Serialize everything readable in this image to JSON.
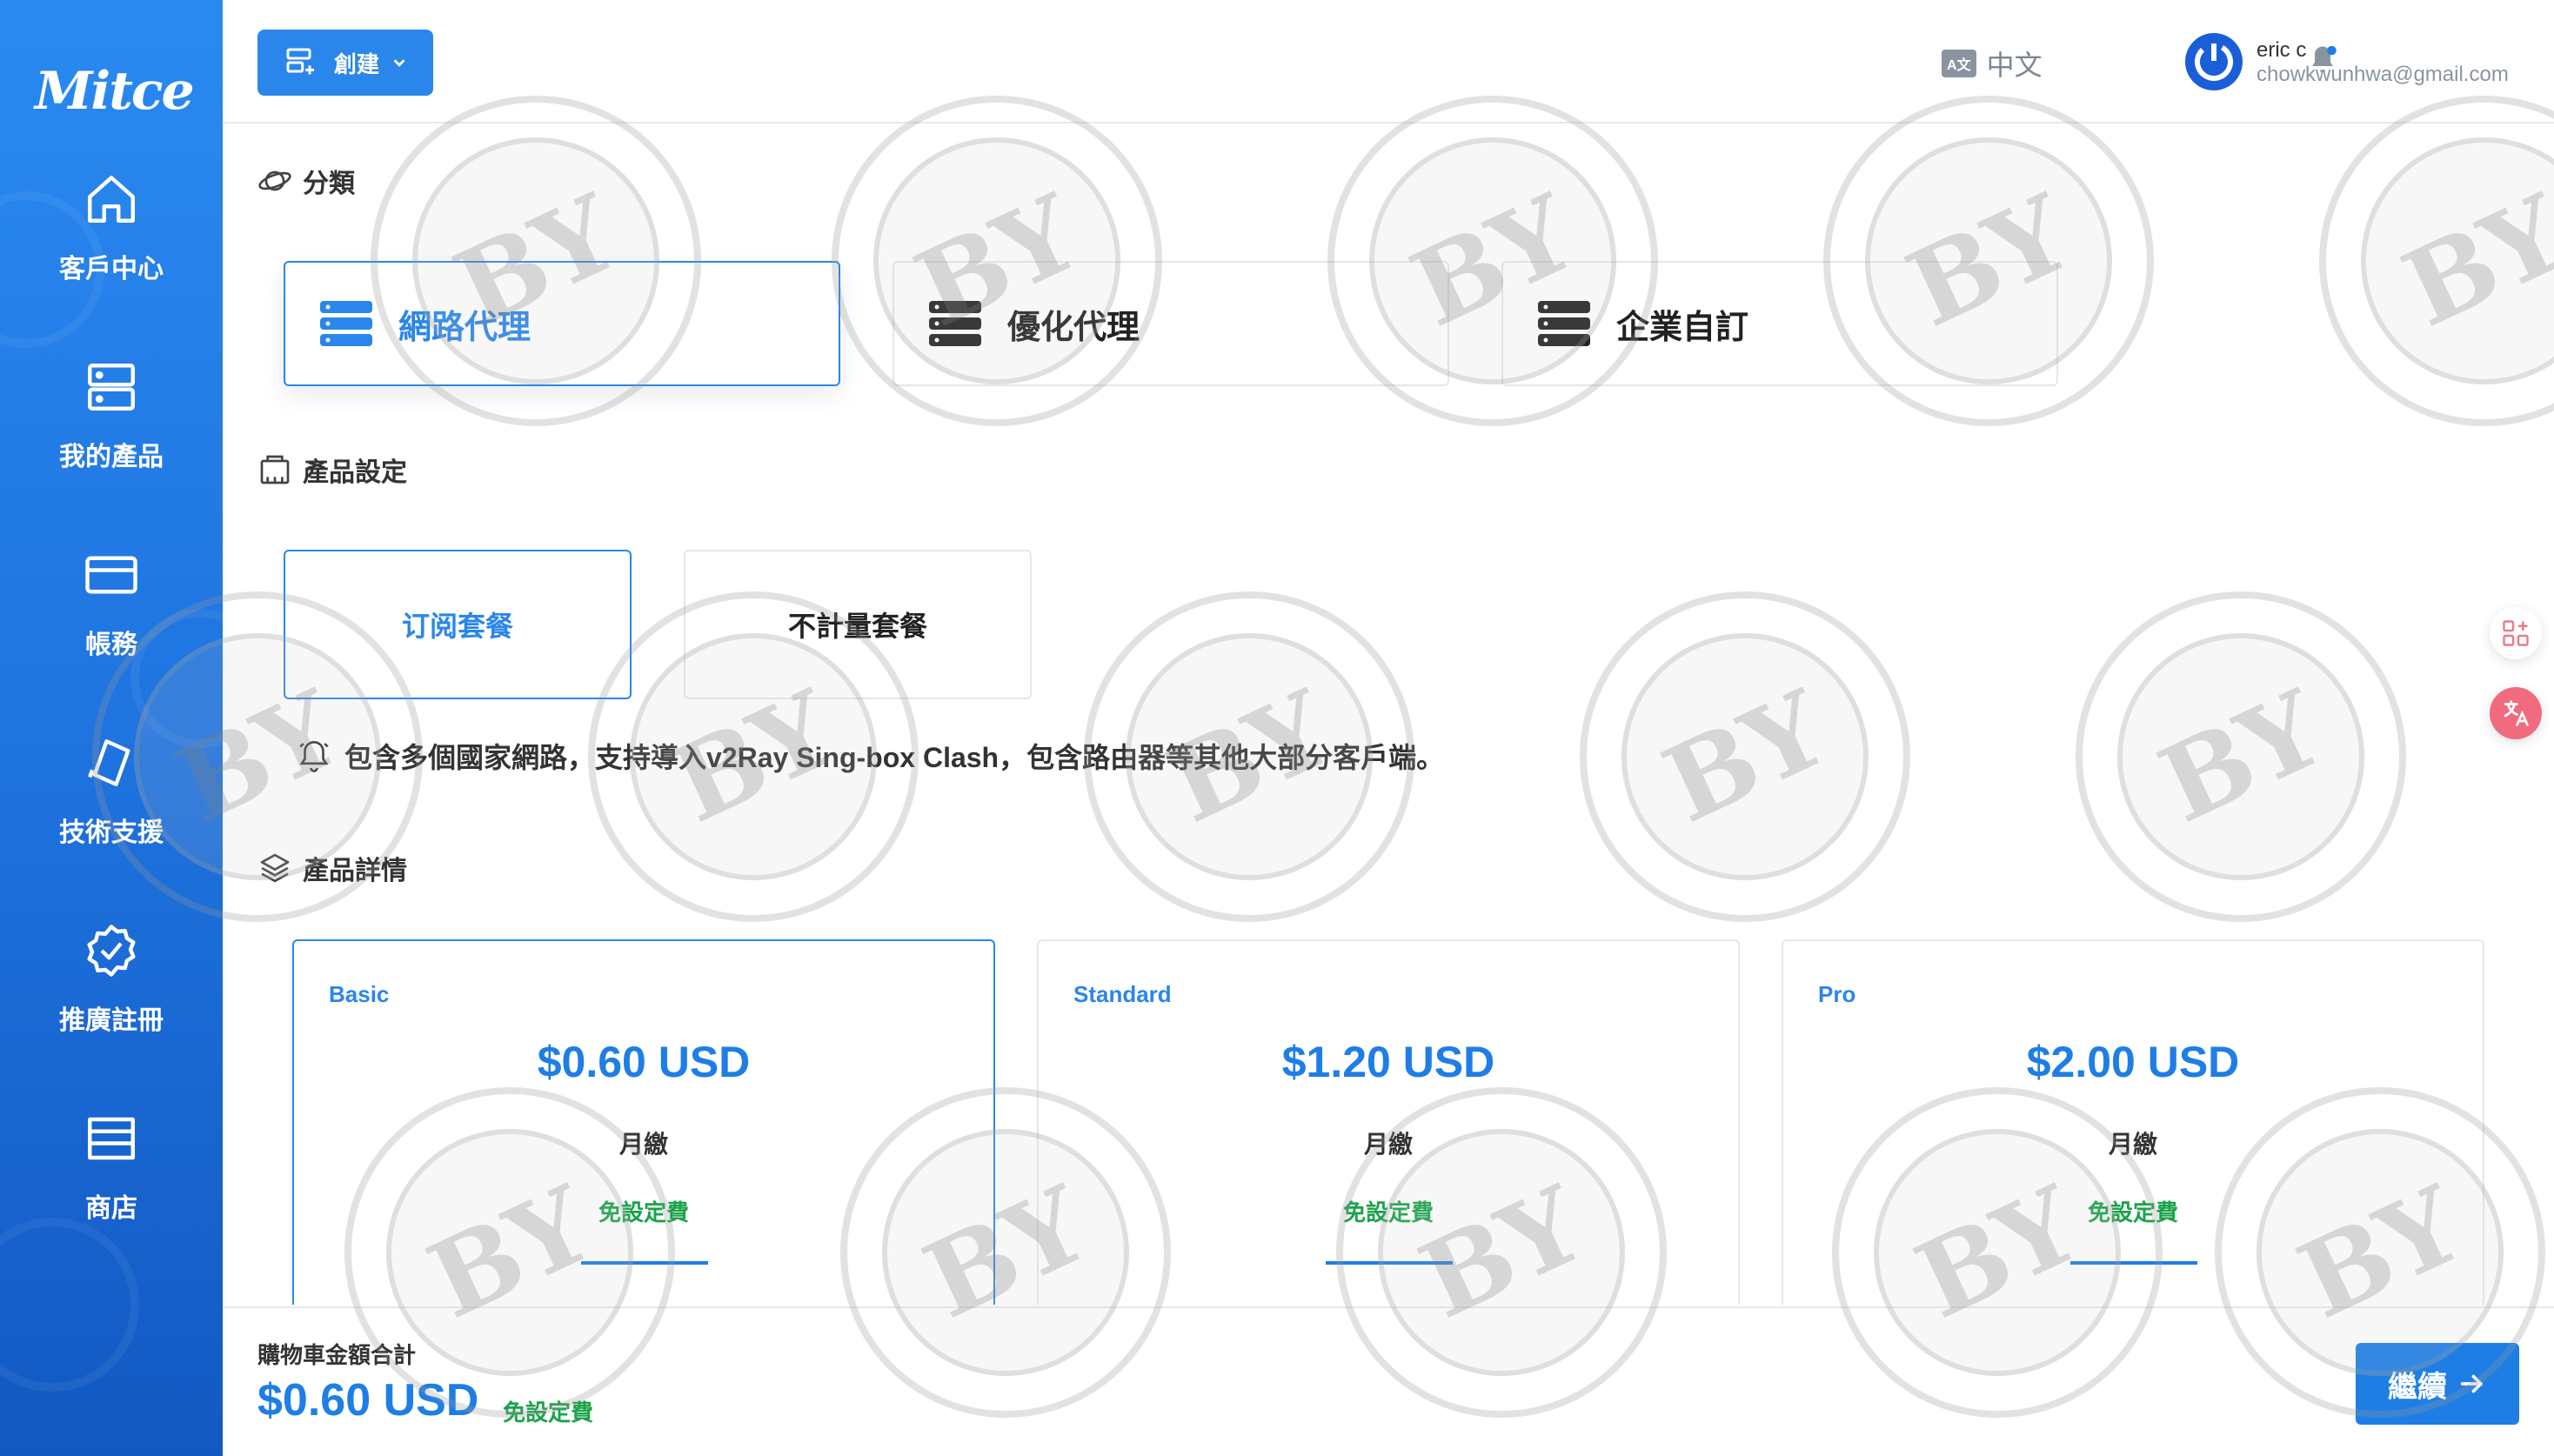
{
  "app": {
    "logo_text": "Mitce"
  },
  "sidebar": {
    "items": [
      {
        "label": "客戶中心",
        "icon": "home-icon"
      },
      {
        "label": "我的產品",
        "icon": "server-icon"
      },
      {
        "label": "帳務",
        "icon": "credit-card-icon"
      },
      {
        "label": "技術支援",
        "icon": "ticket-icon"
      },
      {
        "label": "推廣註冊",
        "icon": "badge-check-icon"
      },
      {
        "label": "商店",
        "icon": "store-icon"
      }
    ]
  },
  "header": {
    "create_label": "創建",
    "language_badge": "A文",
    "language_label": "中文",
    "user": {
      "name": "eric c",
      "email": "chowkwunhwa@gmail.com"
    }
  },
  "category": {
    "title": "分類",
    "options": [
      {
        "label": "網路代理",
        "selected": true
      },
      {
        "label": "優化代理",
        "selected": false
      },
      {
        "label": "企業自訂",
        "selected": false
      }
    ]
  },
  "product_settings": {
    "title": "產品設定",
    "plans": [
      {
        "label": "订阅套餐",
        "selected": true
      },
      {
        "label": "不計量套餐",
        "selected": false
      }
    ],
    "notice": "包含多個國家網路，支持導入v2Ray Sing-box Clash，包含路由器等其他大部分客戶端。"
  },
  "product_details": {
    "title": "產品詳情",
    "tiers": [
      {
        "name": "Basic",
        "price": "$0.60 USD",
        "period": "月繳",
        "setup": "免設定費",
        "selected": true
      },
      {
        "name": "Standard",
        "price": "$1.20 USD",
        "period": "月繳",
        "setup": "免設定費",
        "selected": false
      },
      {
        "name": "Pro",
        "price": "$2.00 USD",
        "period": "月繳",
        "setup": "免設定費",
        "selected": false
      }
    ]
  },
  "footer": {
    "total_label": "購物車金額合計",
    "total_value": "$0.60 USD",
    "total_setup": "免設定費",
    "continue_label": "繼續"
  },
  "watermark": {
    "text": "BY"
  },
  "colors": {
    "primary": "#1e7ee6",
    "sidebar": "#2a8af0",
    "success": "#1aa34a"
  }
}
